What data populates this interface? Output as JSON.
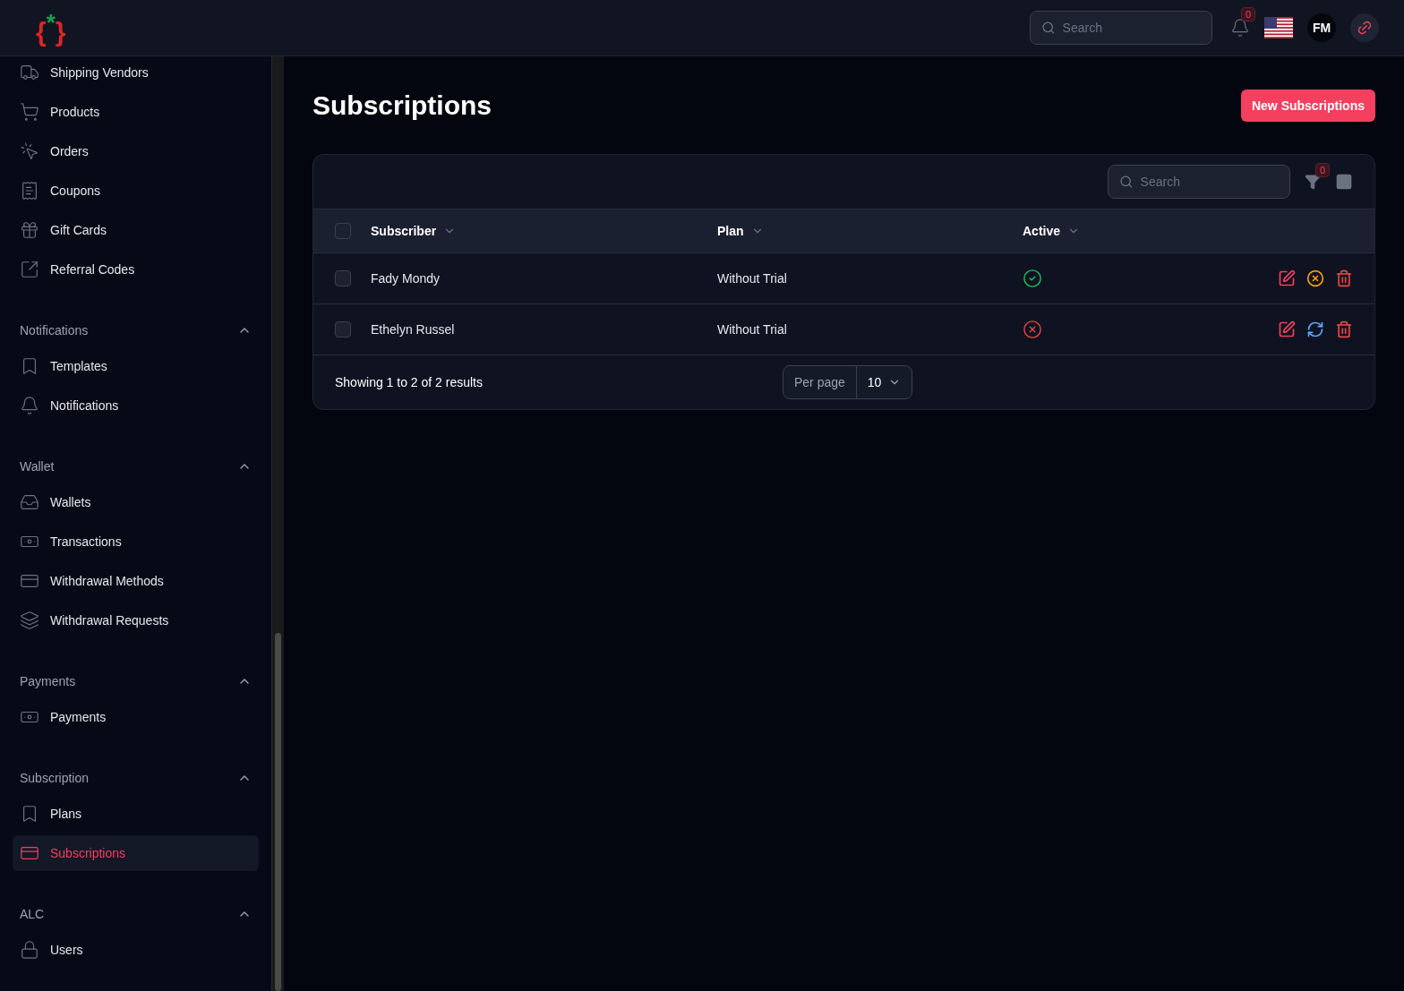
{
  "header": {
    "logo": {
      "left": "{",
      "mark": "*",
      "right": "}"
    },
    "search": {
      "placeholder": "Search"
    },
    "notification_count": "0",
    "avatar": "FM"
  },
  "sidebar": {
    "items": [
      {
        "label": "Shipping Vendors",
        "kind": "truck",
        "selected": false
      },
      {
        "label": "Products",
        "kind": "cart",
        "selected": false
      },
      {
        "label": "Orders",
        "kind": "cursor",
        "selected": false
      },
      {
        "label": "Coupons",
        "kind": "receipt",
        "selected": false
      },
      {
        "label": "Gift Cards",
        "kind": "gift",
        "selected": false
      },
      {
        "label": "Referral Codes",
        "kind": "external",
        "selected": false
      }
    ],
    "sections": [
      {
        "title": "Notifications",
        "expanded": true,
        "items": [
          {
            "label": "Templates",
            "kind": "bookmark",
            "selected": false
          },
          {
            "label": "Notifications",
            "kind": "bell",
            "selected": false
          }
        ]
      },
      {
        "title": "Wallet",
        "expanded": true,
        "items": [
          {
            "label": "Wallets",
            "kind": "inbox",
            "selected": false
          },
          {
            "label": "Transactions",
            "kind": "cash",
            "selected": false
          },
          {
            "label": "Withdrawal Methods",
            "kind": "card",
            "selected": false
          },
          {
            "label": "Withdrawal Requests",
            "kind": "stack",
            "selected": false
          }
        ]
      },
      {
        "title": "Payments",
        "expanded": true,
        "items": [
          {
            "label": "Payments",
            "kind": "cash",
            "selected": false
          }
        ]
      },
      {
        "title": "Subscription",
        "expanded": true,
        "items": [
          {
            "label": "Plans",
            "kind": "bookmark",
            "selected": false
          },
          {
            "label": "Subscriptions",
            "kind": "card",
            "selected": true
          }
        ]
      },
      {
        "title": "ALC",
        "expanded": true,
        "items": [
          {
            "label": "Users",
            "kind": "lock",
            "selected": false
          }
        ]
      }
    ]
  },
  "page": {
    "title": "Subscriptions",
    "new_button": "New Subscriptions"
  },
  "table": {
    "search": {
      "placeholder": "Search"
    },
    "filter_count": "0",
    "all_checked": false,
    "columns": [
      "Subscriber",
      "Plan",
      "Active"
    ],
    "rows": [
      {
        "subscriber": "Fady Mondy",
        "plan": "Without Trial",
        "active": true,
        "checked": false,
        "actions": [
          {
            "kind": "edit"
          },
          {
            "kind": "cancel"
          },
          {
            "kind": "delete"
          }
        ]
      },
      {
        "subscriber": "Ethelyn Russel",
        "plan": "Without Trial",
        "active": false,
        "checked": false,
        "actions": [
          {
            "kind": "edit"
          },
          {
            "kind": "renew"
          },
          {
            "kind": "delete"
          }
        ]
      }
    ],
    "footer": {
      "summary": "Showing 1 to 2 of 2 results",
      "per_page_label": "Per page",
      "per_page": "10"
    }
  }
}
